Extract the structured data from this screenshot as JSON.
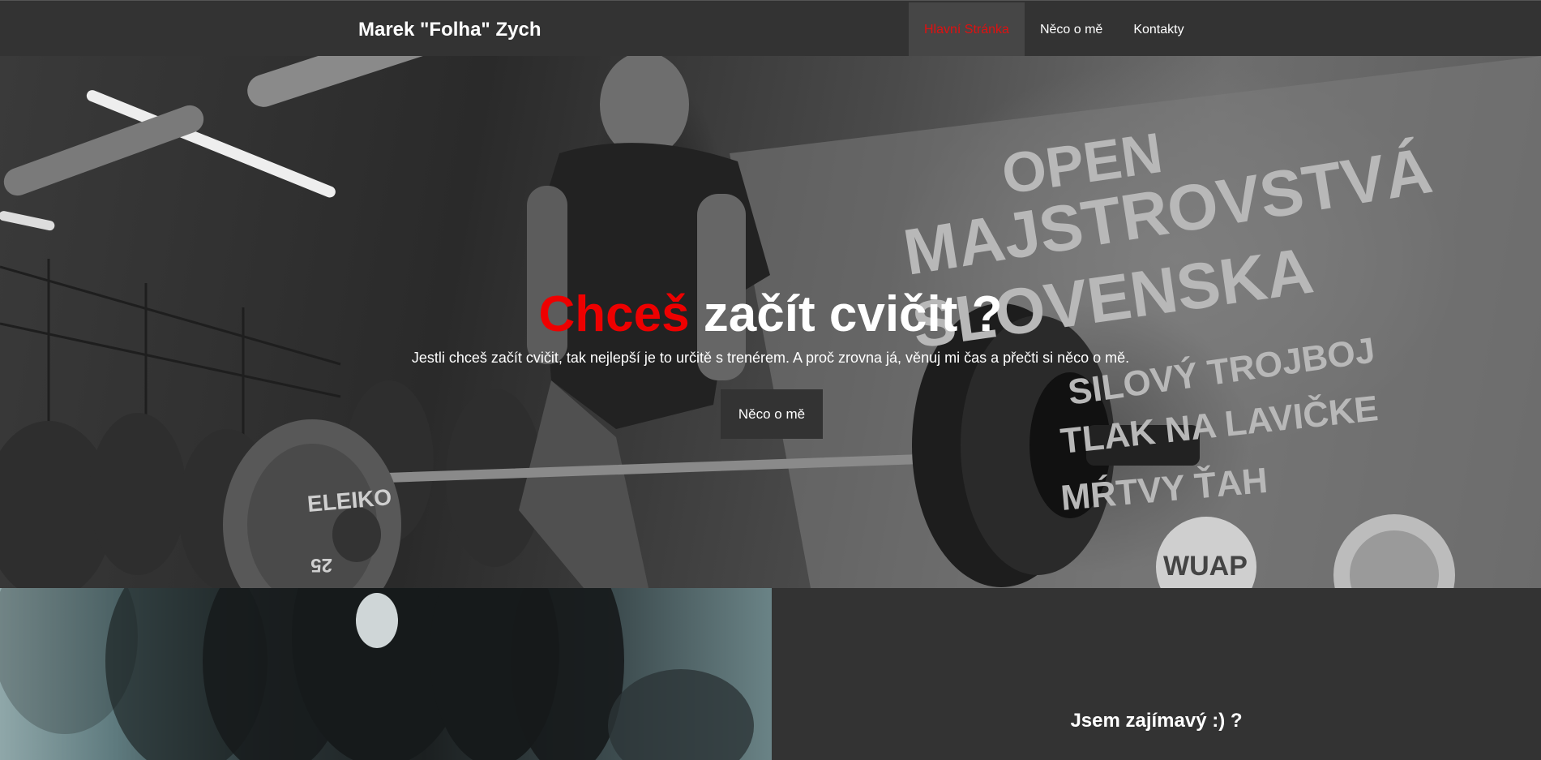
{
  "brand": "Marek \"Folha\" Zych",
  "nav": {
    "items": [
      {
        "label": "Hlavní Stránka",
        "active": true
      },
      {
        "label": "Něco o mě",
        "active": false
      },
      {
        "label": "Kontakty",
        "active": false
      }
    ]
  },
  "hero": {
    "title_accent": "Chceš",
    "title_rest": " začít cvičit ?",
    "subtitle": "Jestli chceš začít cvičit, tak nejlepší je to určitě s trenérem. A proč zrovna já, věnuj mi čas a přečti si něco o mě.",
    "button_label": "Něco o mě",
    "banner_lines": [
      "OPEN",
      "MAJSTROVSTVÁ",
      "SLOVENSKA",
      "SILOVÝ TROJBOJ",
      "TLAK NA LAVIČKE",
      "MŔTVY ŤAH"
    ],
    "plate_brand": "ELEIKO",
    "plate_number": "25",
    "logo_text": "WUAP"
  },
  "section": {
    "heading": "Jsem zajímavý :) ?"
  },
  "colors": {
    "accent": "#ee0000",
    "nav_bg": "#333333",
    "nav_active_bg": "#464646",
    "button_bg": "#333333"
  }
}
